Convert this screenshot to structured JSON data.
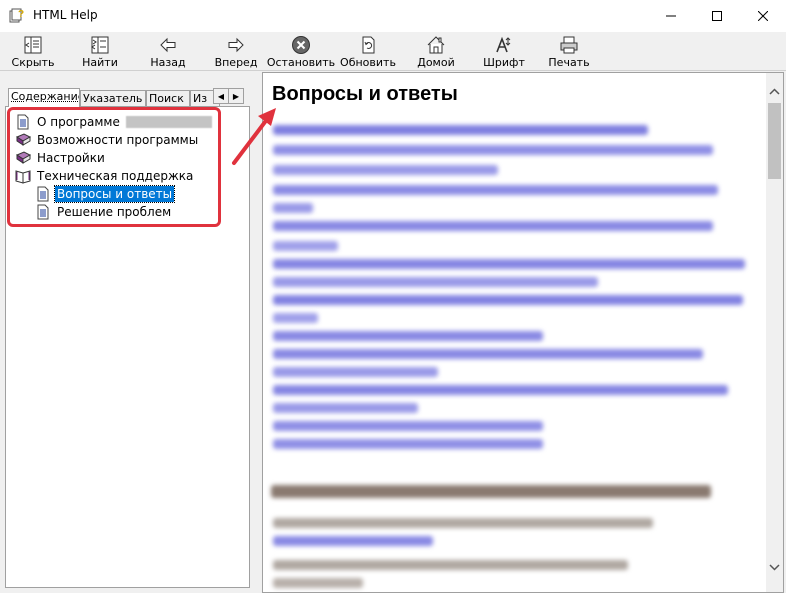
{
  "window": {
    "title": "HTML Help",
    "controls": [
      "minimize",
      "maximize",
      "close"
    ]
  },
  "toolbar": {
    "buttons": [
      {
        "label": "Скрыть",
        "icon": "hide-icon"
      },
      {
        "label": "Найти",
        "icon": "locate-icon"
      },
      {
        "label": "Назад",
        "icon": "back-arrow-icon"
      },
      {
        "label": "Вперед",
        "icon": "forward-arrow-icon"
      },
      {
        "label": "Остановить",
        "icon": "stop-icon"
      },
      {
        "label": "Обновить",
        "icon": "refresh-icon"
      },
      {
        "label": "Домой",
        "icon": "home-icon"
      },
      {
        "label": "Шрифт",
        "icon": "font-icon"
      },
      {
        "label": "Печать",
        "icon": "print-icon"
      }
    ]
  },
  "nav": {
    "tabs": [
      "Содержание",
      "Указатель",
      "Поиск",
      "Из"
    ],
    "active_tab": "Содержание",
    "tree": [
      {
        "label": "О программе",
        "icon": "page-icon",
        "level": 0
      },
      {
        "label": "Возможности программы",
        "icon": "closed-book-icon",
        "level": 0
      },
      {
        "label": "Настройки",
        "icon": "closed-book-icon",
        "level": 0
      },
      {
        "label": "Техническая поддержка",
        "icon": "open-book-icon",
        "level": 0
      },
      {
        "label": "Вопросы и ответы",
        "icon": "page-icon",
        "level": 1,
        "selected": true
      },
      {
        "label": "Решение проблем",
        "icon": "page-icon",
        "level": 1
      }
    ]
  },
  "content": {
    "heading": "Вопросы и ответы"
  },
  "colors": {
    "highlight_red": "#e0323d",
    "selection_blue": "#0078d7",
    "link_blue": "#3a3ad9"
  }
}
